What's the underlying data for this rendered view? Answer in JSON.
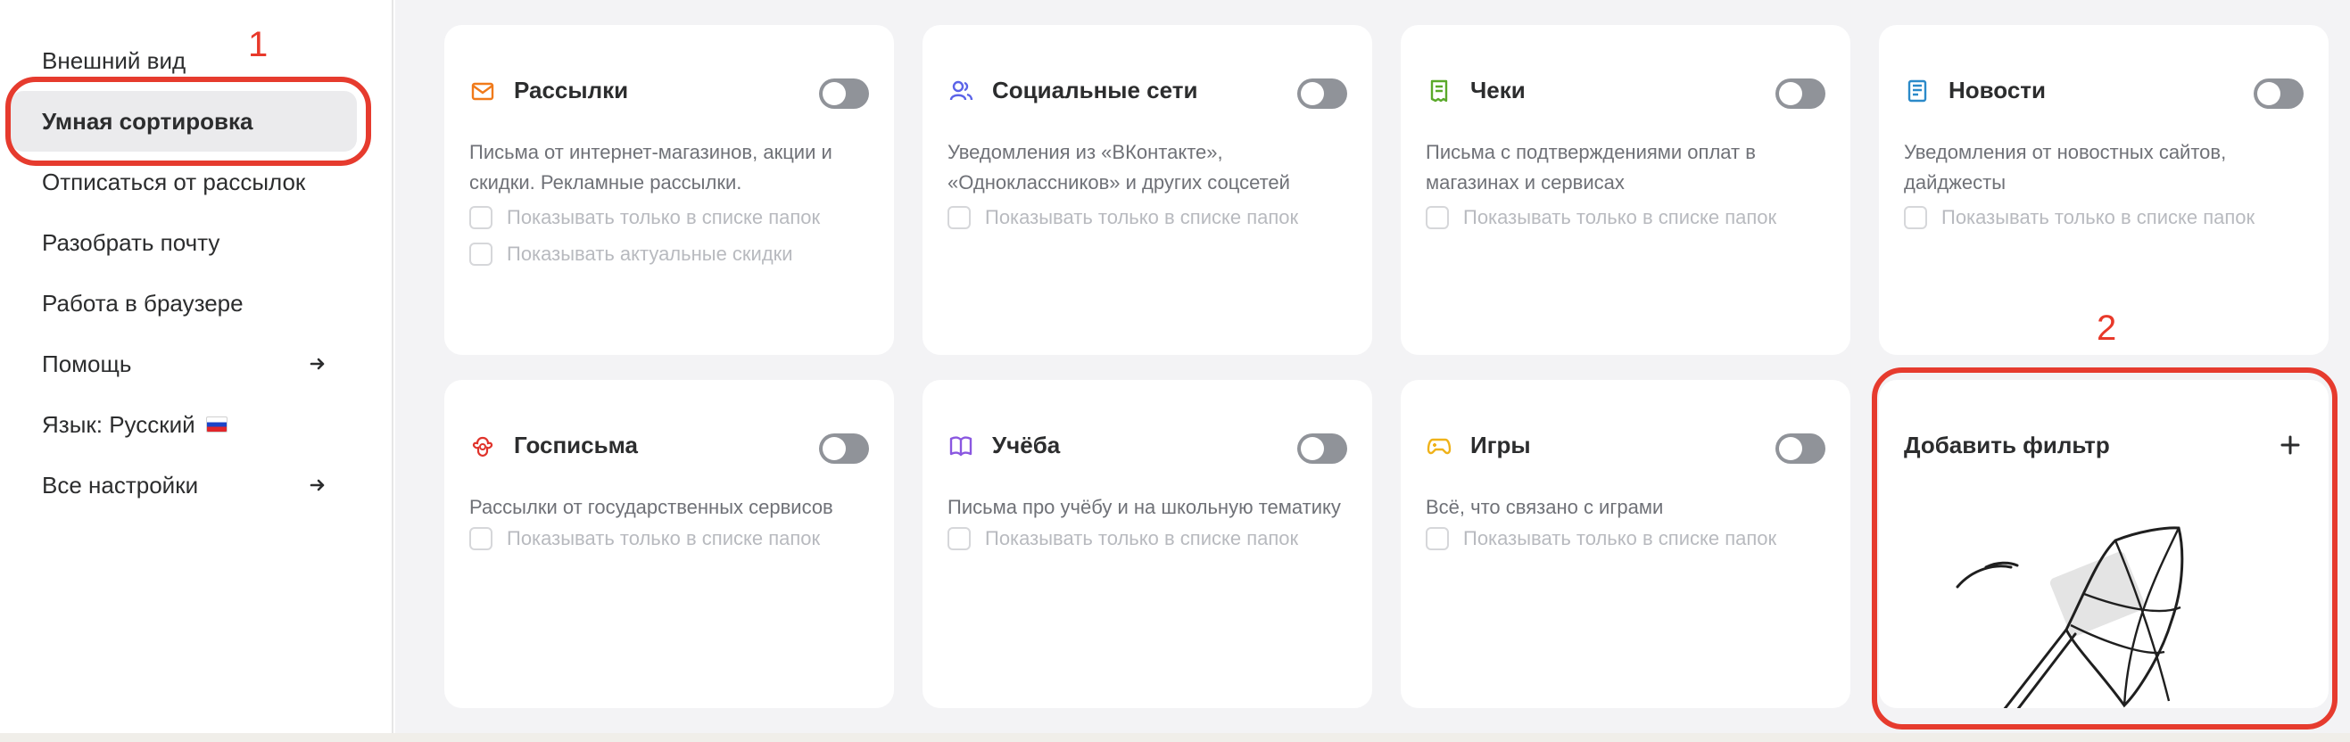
{
  "sidebar": {
    "items": [
      {
        "label": "Внешний вид"
      },
      {
        "label": "Умная сортировка"
      },
      {
        "label": "Отписаться от рассылок"
      },
      {
        "label": "Разобрать почту"
      },
      {
        "label": "Работа в браузере"
      },
      {
        "label": "Помощь"
      },
      {
        "label": "Язык: Русский"
      },
      {
        "label": "Все настройки"
      }
    ]
  },
  "annotations": {
    "marker_1": "1",
    "marker_2": "2",
    "highlight_color": "#e63b2e"
  },
  "cards": [
    {
      "title": "Рассылки",
      "icon": "envelope-icon",
      "icon_color": "#f07a1a",
      "enabled": false,
      "description": "Письма от интернет-магазинов, акции и скидки. Рекламные рассылки.",
      "options": [
        "Показывать только в списке папок",
        "Показывать актуальные скидки"
      ]
    },
    {
      "title": "Социальные сети",
      "icon": "people-icon",
      "icon_color": "#5b63e8",
      "enabled": false,
      "description": "Уведомления из «ВКонтакте», «Одноклассников» и других соцсетей",
      "options": [
        "Показывать только в списке папок"
      ]
    },
    {
      "title": "Чеки",
      "icon": "receipt-icon",
      "icon_color": "#5aa92a",
      "enabled": false,
      "description": "Письма с подтверждениями оплат в магазинах и сервисах",
      "options": [
        "Показывать только в списке папок"
      ]
    },
    {
      "title": "Новости",
      "icon": "newspaper-icon",
      "icon_color": "#2b8ac9",
      "enabled": false,
      "description": "Уведомления от новостных сайтов, дайджесты",
      "options": [
        "Показывать только в списке папок"
      ]
    },
    {
      "title": "Госписьма",
      "icon": "emblem-icon",
      "icon_color": "#e0332b",
      "enabled": false,
      "description": "Рассылки от государственных сервисов",
      "options": [
        "Показывать только в списке папок"
      ]
    },
    {
      "title": "Учёба",
      "icon": "book-icon",
      "icon_color": "#8a57e0",
      "enabled": false,
      "description": "Письма про учёбу и на школьную тематику",
      "options": [
        "Показывать только в списке папок"
      ]
    },
    {
      "title": "Игры",
      "icon": "gamepad-icon",
      "icon_color": "#efb21a",
      "enabled": false,
      "description": "Всё, что связано с играми",
      "options": [
        "Показывать только в списке папок"
      ]
    }
  ],
  "add_filter": {
    "label": "Добавить фильтр",
    "icon": "plus-icon"
  }
}
